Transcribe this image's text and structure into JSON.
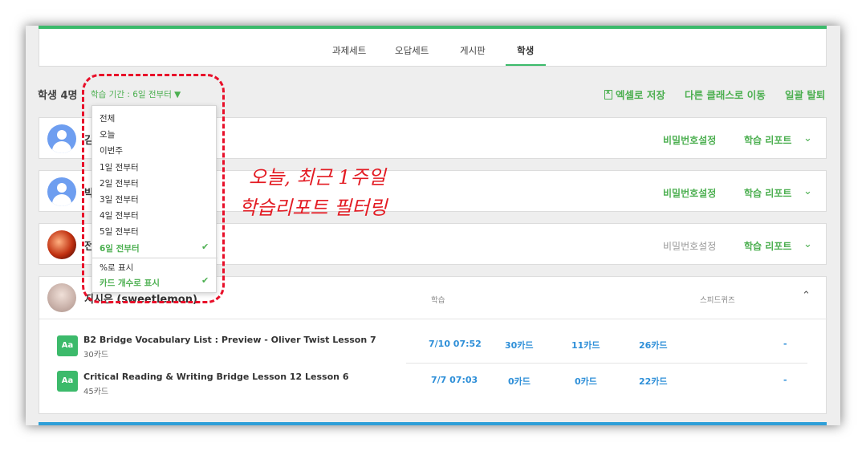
{
  "tabs": [
    "과제세트",
    "오답세트",
    "게시판",
    "학생"
  ],
  "active_tab": "학생",
  "toolbar": {
    "student_count": "학생 4명",
    "period_filter": "학습 기간 : 6일 전부터 ▼",
    "excel_save": "엑셀로 저장",
    "move_class": "다른 클래스로 이동",
    "bulk_leave": "일괄 탈퇴"
  },
  "students": [
    {
      "name": "김",
      "password_label": "비밀번호설정",
      "report_label": "학습 리포트",
      "password_enabled": true
    },
    {
      "name": "박",
      "password_label": "비밀번호설정",
      "report_label": "학습 리포트",
      "password_enabled": true
    },
    {
      "name": "전",
      "password_label": "비밀번호설정",
      "report_label": "학습 리포트",
      "password_enabled": false
    },
    {
      "name": "지시은 (sweetlemon)"
    }
  ],
  "expanded": {
    "col_study": "학습",
    "col_quiz": "스피드퀴즈",
    "rows": [
      {
        "icon": "Aa",
        "title": "B2 Bridge Vocabulary List : Preview - Oliver Twist Lesson 7",
        "sub": "30카드",
        "date": "7/10 07:52",
        "c1": "30카드",
        "c2": "11카드",
        "c3": "26카드",
        "quiz": "-"
      },
      {
        "icon": "Aa",
        "title": "Critical Reading & Writing Bridge Lesson 12 Lesson 6",
        "sub": "45카드",
        "date": "7/7 07:03",
        "c1": "0카드",
        "c2": "0카드",
        "c3": "22카드",
        "quiz": "-"
      }
    ]
  },
  "dropdown": {
    "items": [
      "전체",
      "오늘",
      "이번주",
      "1일 전부터",
      "2일 전부터",
      "3일 전부터",
      "4일 전부터",
      "5일 전부터",
      "6일 전부터"
    ],
    "selected": "6일 전부터",
    "display_options": [
      "%로 표시",
      "카드 개수로 표시"
    ],
    "display_selected": "카드 개수로 표시"
  },
  "annotation": {
    "line1": "오늘, 최근 1주일",
    "line2": "학습리포트 필터링"
  },
  "colors": {
    "accent": "#3cba6b",
    "link": "#2e8fd8",
    "annotation": "#e31b23"
  }
}
